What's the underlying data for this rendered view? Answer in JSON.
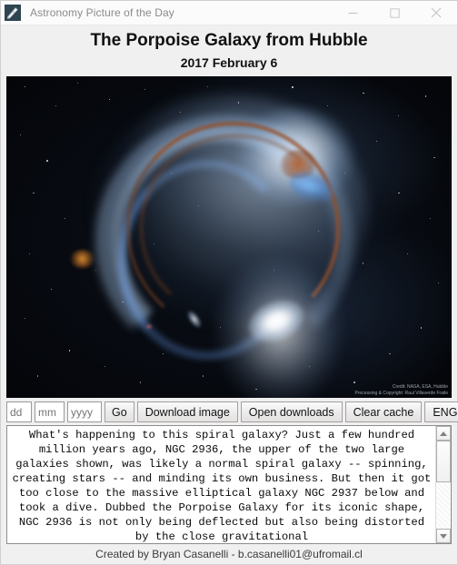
{
  "window": {
    "title": "Astronomy Picture of the Day",
    "app_icon": "telescope-icon",
    "controls": {
      "minimize": "minimize-icon",
      "maximize": "maximize-icon",
      "close": "close-icon"
    }
  },
  "apod": {
    "title": "The Porpoise Galaxy from Hubble",
    "date": "2017 February 6",
    "image_alt": "The Porpoise Galaxy (NGC 2936) interacting with elliptical galaxy NGC 2937",
    "credit_line1": "Credit: NASA, ESA, Hubble",
    "credit_line2": "Processing & Copyright: Raul Villaverde Fraile"
  },
  "toolbar": {
    "day_placeholder": "dd",
    "day_value": "",
    "month_placeholder": "mm",
    "month_value": "",
    "year_placeholder": "yyyy",
    "year_value": "",
    "go_label": "Go",
    "download_label": "Download image",
    "open_downloads_label": "Open downloads",
    "clear_cache_label": "Clear cache",
    "language_selected": "ENG",
    "language_options": [
      "ENG"
    ],
    "prev_label": "<-",
    "next_label": "->"
  },
  "description": {
    "text": "What's happening to this spiral galaxy? Just a few hundred million years ago, NGC 2936, the upper of the two large galaxies shown, was likely a normal spiral galaxy -- spinning, creating stars -- and minding its own business. But then it got too close to the massive elliptical galaxy NGC 2937 below and took a dive. Dubbed the Porpoise Galaxy for its iconic shape, NGC 2936 is not only being deflected but also being distorted by the close gravitational"
  },
  "footer": {
    "credit": "Created by Bryan Casanelli - b.casanelli01@ufromail.cl"
  },
  "colors": {
    "window_bg": "#f0f0f0",
    "titlebar_bg": "#fbfbfb",
    "title_text": "#8b8b8b",
    "heading_text": "#111111",
    "button_face": "#ececec",
    "border": "#a0a0a0",
    "text_bg": "#ffffff"
  }
}
